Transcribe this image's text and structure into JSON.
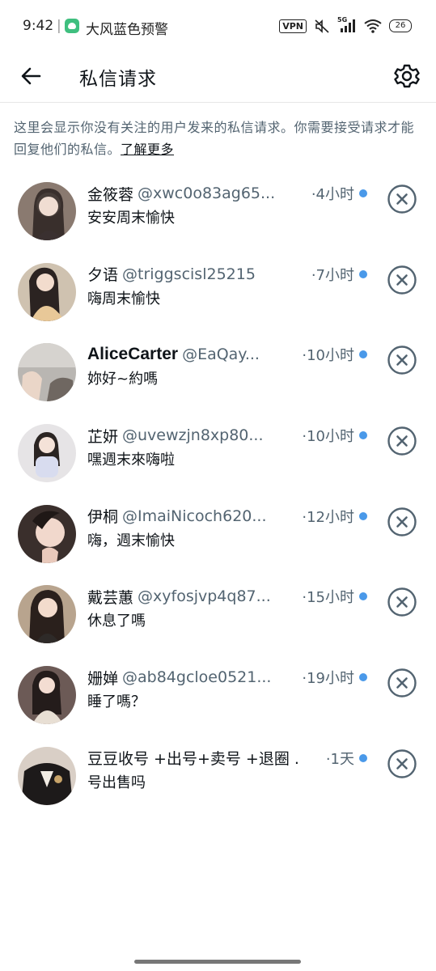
{
  "status_bar": {
    "time": "9:42",
    "separator": "|",
    "alert_text": "大风蓝色预警",
    "vpn": "VPN",
    "network": "5G",
    "battery": "26"
  },
  "header": {
    "title": "私信请求"
  },
  "info": {
    "text": "这里会显示你没有关注的用户发来的私信请求。你需要接受请求才能回复他们的私信。",
    "learn_more": "了解更多"
  },
  "requests": [
    {
      "name": "金筱蓉",
      "handle": "@xwc0o83ag65...",
      "time": "·4小时",
      "message": "安安周末愉快"
    },
    {
      "name": "夕语",
      "handle": "@triggscisl25215",
      "time": "·7小时",
      "message": "嗨周末愉快"
    },
    {
      "name": "AliceCarter",
      "handle": "@EaQay...",
      "time": "·10小时",
      "message": "妳好~約嗎"
    },
    {
      "name": "芷妍",
      "handle": "@uvewzjn8xp80...",
      "time": "·10小时",
      "message": "嘿週末來嗨啦"
    },
    {
      "name": "伊桐",
      "handle": "@ImaiNicoch620...",
      "time": "·12小时",
      "message": "嗨，週末愉快"
    },
    {
      "name": "戴芸蕙",
      "handle": "@xyfosjvp4q87...",
      "time": "·15小时",
      "message": "休息了嗎"
    },
    {
      "name": "姗婵",
      "handle": "@ab84gcloe0521...",
      "time": "·19小时",
      "message": "睡了嗎？"
    },
    {
      "name": "豆豆收号 +出号+卖号 +退圈 .",
      "handle": "",
      "time": "·1天",
      "message": "号出售吗"
    }
  ],
  "colors": {
    "unread_dot": "#4a99e9",
    "secondary_text": "#536471",
    "primary_text": "#0f1419"
  }
}
